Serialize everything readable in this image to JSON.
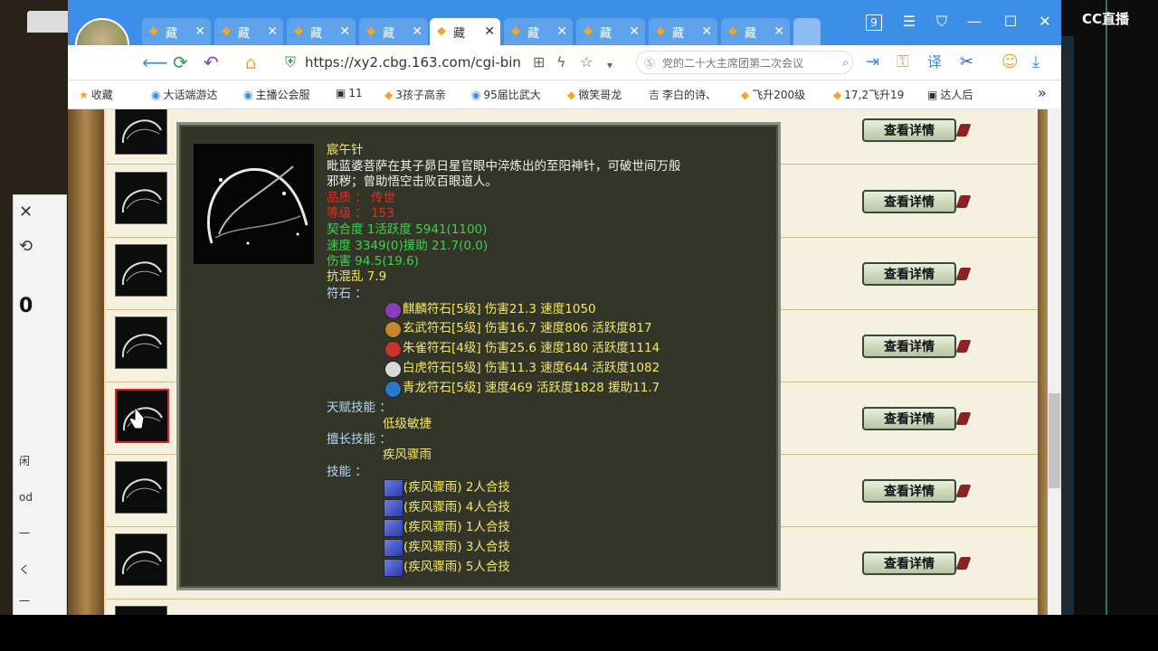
{
  "browser": {
    "tabs": [
      {
        "label": "藏"
      },
      {
        "label": "藏"
      },
      {
        "label": "藏"
      },
      {
        "label": "藏"
      },
      {
        "label": "藏"
      },
      {
        "label": "藏"
      },
      {
        "label": "藏"
      },
      {
        "label": "藏"
      },
      {
        "label": "藏"
      }
    ],
    "window_badge": "9",
    "url": "https://xy2.cbg.163.com/cgi-bin",
    "search_placeholder": "党的二十大主席团第二次会议"
  },
  "bookmarks": [
    {
      "label": "收藏",
      "icon": "star-icon"
    },
    {
      "label": "大话端游达",
      "icon": "globe-icon"
    },
    {
      "label": "主播公会服",
      "icon": "globe-icon"
    },
    {
      "label": "11",
      "icon": "page-icon"
    },
    {
      "label": "3孩子高亲",
      "icon": "game-icon"
    },
    {
      "label": "95届比武大",
      "icon": "globe-icon"
    },
    {
      "label": "微笑哥龙",
      "icon": "game-icon"
    },
    {
      "label": "李白的诗、",
      "icon": "text-icon"
    },
    {
      "label": "飞升200级",
      "icon": "game-icon"
    },
    {
      "label": "17,2飞升19",
      "icon": "game-icon"
    },
    {
      "label": "达人后",
      "icon": "page-icon"
    }
  ],
  "left_panel": {
    "count": "0",
    "items": [
      "闲",
      "od",
      "一",
      "く",
      "一"
    ]
  },
  "list": {
    "detail_label": "查看详情",
    "row_count": 7
  },
  "tooltip": {
    "name": "宸午针",
    "description_1": "毗蓝婆菩萨在其子昴日星官眼中淬炼出的至阳神针，可破世间万般",
    "description_2": "邪秽；曾助悟空击败百眼道人。",
    "quality": "品质  ：  传世",
    "level": "等级  ：  153",
    "stats_1": "契合度          1活跃度    5941(1100)",
    "stats_2": "速度          3349(0)援助          21.7(0.0)",
    "stats_3": "伤害        94.5(19.6)",
    "stats_4": "抗混乱  7.9",
    "runes_label": "符石  ：",
    "runes": [
      {
        "text": "麒麟符石[5级] 伤害21.3  速度1050",
        "color": "#8a3db8"
      },
      {
        "text": "玄武符石[5级] 伤害16.7  速度806  活跃度817",
        "color": "#c08a2a"
      },
      {
        "text": "朱雀符石[4级] 伤害25.6  速度180  活跃度1114",
        "color": "#c8322a"
      },
      {
        "text": "白虎符石[5级] 伤害11.3  速度644  活跃度1082",
        "color": "#d8d8d8"
      },
      {
        "text": "青龙符石[5级] 速度469  活跃度1828  援助11.7",
        "color": "#2a78c8"
      }
    ],
    "talent_label": "天赋技能  ：",
    "talent": "低级敏捷",
    "specialty_label": "擅长技能  ：",
    "specialty": "疾风骤雨",
    "skills_label": "技能  ：",
    "skills": [
      "(疾风骤雨)  2人合技",
      "(疾风骤雨)  4人合技",
      "(疾风骤雨)  1人合技",
      "(疾风骤雨)  3人合技",
      "(疾风骤雨)  5人合技"
    ]
  },
  "overlay": {
    "logo": "CC直播"
  }
}
